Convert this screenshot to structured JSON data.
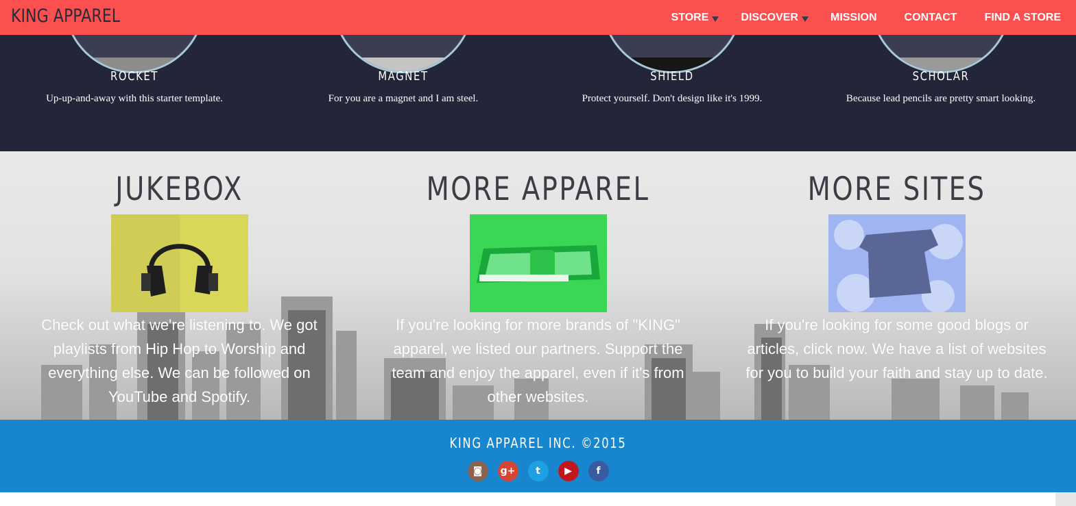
{
  "nav": {
    "brand": "KING APPAREL",
    "items": [
      {
        "label": "STORE",
        "dropdown": true
      },
      {
        "label": "DISCOVER",
        "dropdown": true
      },
      {
        "label": "MISSION",
        "dropdown": false
      },
      {
        "label": "CONTACT",
        "dropdown": false
      },
      {
        "label": "FIND A STORE",
        "dropdown": false
      }
    ]
  },
  "products": [
    {
      "name": "ROCKET",
      "desc": "Up-up-and-away with this starter template."
    },
    {
      "name": "MAGNET",
      "desc": "For you are a magnet and I am steel."
    },
    {
      "name": "SHIELD",
      "desc": "Protect yourself. Don't design like it's 1999."
    },
    {
      "name": "SCHOLAR",
      "desc": "Because lead pencils are pretty smart looking."
    }
  ],
  "features": [
    {
      "title": "JUKEBOX",
      "text": "Check out what we're listening to. We got playlists from Hip Hop to Worship and everything else. We can be followed on YouTube and Spotify.",
      "tile_color": "#d9d75a"
    },
    {
      "title": "MORE APPAREL",
      "text": "If you're looking for more brands of \"KING\" apparel, we listed our partners. Support the team and enjoy the apparel, even if it's from other websites.",
      "tile_color": "#3bd654"
    },
    {
      "title": "MORE SITES",
      "text": "If you're looking for some good blogs or articles, click now. We have a list of websites for you to build your faith and stay up to date.",
      "tile_color": "#9fb4f0"
    }
  ],
  "footer": {
    "copyright": "KING APPAREL INC. ©2015",
    "socials": [
      {
        "name": "instagram-icon",
        "glyph": "◙",
        "color": "#8a6250"
      },
      {
        "name": "google-plus-icon",
        "glyph": "g+",
        "color": "#d54535"
      },
      {
        "name": "twitter-icon",
        "glyph": "t",
        "color": "#1da1e2"
      },
      {
        "name": "youtube-icon",
        "glyph": "▶",
        "color": "#c0181f"
      },
      {
        "name": "facebook-icon",
        "glyph": "f",
        "color": "#3b5ba0"
      }
    ]
  },
  "colors": {
    "nav_bg": "#fc5050",
    "dark_bg": "#232538",
    "footer_bg": "#1786cf",
    "title_text": "#3c3c44"
  }
}
